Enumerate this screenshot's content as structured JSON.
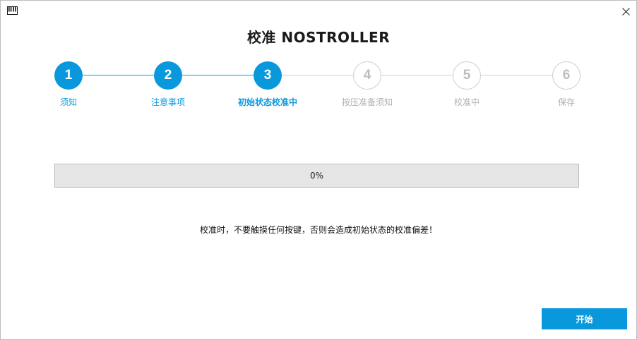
{
  "window": {
    "app_icon": "piano-keys-icon",
    "close_icon": "close-icon"
  },
  "title": "校准 NOSTROLLER",
  "steps": [
    {
      "number": "1",
      "label": "须知",
      "state": "done"
    },
    {
      "number": "2",
      "label": "注意事项",
      "state": "done"
    },
    {
      "number": "3",
      "label": "初始状态校准中",
      "state": "current"
    },
    {
      "number": "4",
      "label": "按压准备须知",
      "state": "pending"
    },
    {
      "number": "5",
      "label": "校准中",
      "state": "pending"
    },
    {
      "number": "6",
      "label": "保存",
      "state": "pending"
    }
  ],
  "progress": {
    "value": 0,
    "text": "0%"
  },
  "warning": "校准时，不要触摸任何按键，否则会造成初始状态的校准偏差！",
  "start_button": "开始",
  "colors": {
    "accent": "#0a98dc",
    "inactive_border": "#cfcfcf",
    "inactive_text": "#b0b0b0",
    "progress_track": "#e6e6e6"
  }
}
